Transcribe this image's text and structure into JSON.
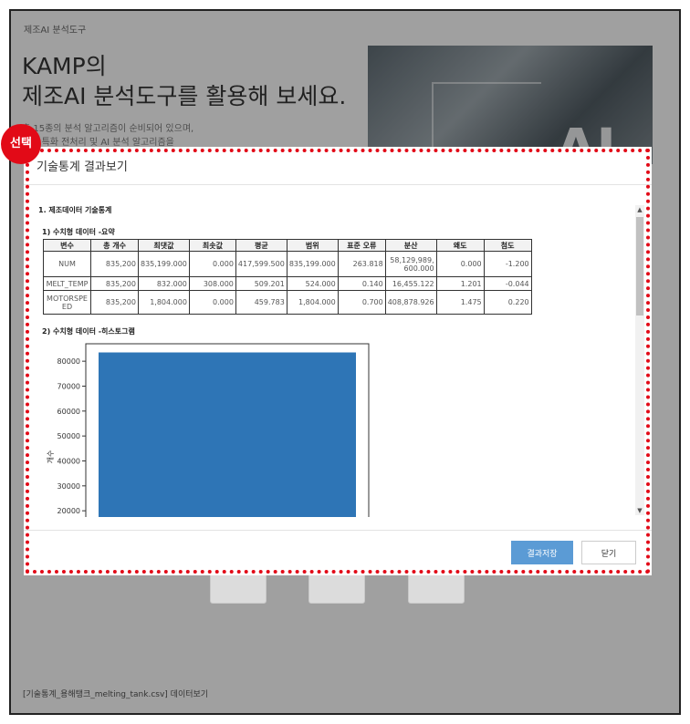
{
  "page": {
    "label": "제조AI 분석도구",
    "hero_title_line1": "KAMP의",
    "hero_title_line2": "제조AI 분석도구를 활용해 보세요.",
    "hero_desc_line1": "총 15종의 분석 알고리즘이 순비되어 있으며,",
    "hero_desc_line2": "제조 특화 전처리 및 AI 분석 알고리즘을",
    "hero_image_text": "AI",
    "bottom_caption": "[기술통계_용해탱크_melting_tank.csv] 데이터보기"
  },
  "annotation": {
    "badge_label": "선택",
    "frame_color": "#e20a17"
  },
  "modal": {
    "title": "기술통계 결과보기",
    "section1": "1. 제조데이터 기술통계",
    "section1_1": "1) 수치형 데이터 -요약",
    "section1_2": "2) 수치형 데이터 -히스토그램",
    "table": {
      "headers": [
        "변수",
        "총 개수",
        "최댓값",
        "최솟값",
        "평균",
        "범위",
        "표준 오류",
        "분산",
        "왜도",
        "첨도"
      ],
      "rows": [
        [
          "NUM",
          "835,200",
          "835,199.000",
          "0.000",
          "417,599.500",
          "835,199.000",
          "263.818",
          "58,129,989,600.000",
          "0.000",
          "-1.200"
        ],
        [
          "MELT_TEMP",
          "835,200",
          "832.000",
          "308.000",
          "509.201",
          "524.000",
          "0.140",
          "16,455.122",
          "1.201",
          "-0.044"
        ],
        [
          "MOTORSPEED",
          "835,200",
          "1,804.000",
          "0.000",
          "459.783",
          "1,804.000",
          "0.700",
          "408,878.926",
          "1.475",
          "0.220"
        ]
      ]
    },
    "save_label": "결과저장",
    "close_label": "닫기",
    "scroll_up": "▲",
    "scroll_down": "▼"
  },
  "chart_data": {
    "type": "bar",
    "title": "",
    "xlabel": "",
    "ylabel": "개수",
    "yticks": [
      20000,
      30000,
      40000,
      50000,
      60000,
      70000,
      80000
    ],
    "ylim": [
      17500,
      87000
    ],
    "categories": [
      ""
    ],
    "values": [
      83520
    ],
    "bar_color": "#2e75b6",
    "grid": false
  }
}
